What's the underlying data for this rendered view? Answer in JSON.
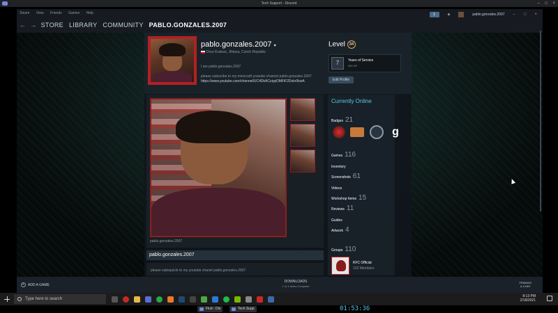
{
  "discord": {
    "title": "Tech Support - Discord"
  },
  "menubar": [
    "Steam",
    "View",
    "Friends",
    "Games",
    "Help"
  ],
  "account": {
    "badge": "1",
    "name": "pablo.gonzales.2007"
  },
  "nav": {
    "back": "←",
    "forward": "→",
    "store": "STORE",
    "library": "LIBRARY",
    "community": "COMMUNITY",
    "current": "PABLO.GONZALES.2007"
  },
  "profile": {
    "name": "pablo.gonzales.2007",
    "location": "Dvur Kralove, Jihlava, Czech Republic",
    "summary1": "I am pablo.gonzales.2007",
    "summary2": "please subscribe to my minecraft youtube channel  pablo.gonzales.2007",
    "summary3": "https://www.youtube.com/channel/UC4DkACoiypDMFiF2Dokr0kwA"
  },
  "level": {
    "label": "Level",
    "value": "34",
    "badge_title": "Years of Service",
    "badge_xp": "350 XP",
    "edit": "Edit Profile"
  },
  "showcase": {
    "caption": "pablo.gonzales.2007"
  },
  "box2": {
    "header": "pablo.gonzales.2007",
    "text": "please subsquicle to my youtube chanel pablo.gonzales.2007"
  },
  "side": {
    "online": "Currently Online",
    "badges": {
      "label": "Badges",
      "count": "21"
    },
    "games": {
      "label": "Games",
      "count": "116"
    },
    "inventory": "Inventory",
    "screenshots": {
      "label": "Screenshots",
      "count": "61"
    },
    "videos": "Videos",
    "workshop": {
      "label": "Workshop Items",
      "count": "15"
    },
    "reviews": {
      "label": "Reviews",
      "count": "11"
    },
    "guides": "Guides",
    "artwork": {
      "label": "Artwork",
      "count": "4"
    },
    "groups": {
      "label": "Groups",
      "count": "110"
    },
    "group_name": "KFC Official",
    "group_members": "123 Members"
  },
  "badge_g": "g",
  "footer": {
    "add": "ADD A GAME",
    "downloads": "DOWNLOADS",
    "downloads_sub": "1 of 1 Items Complete",
    "friends1": "FRIENDS",
    "friends2": "& CHAT"
  },
  "taskbar": {
    "search": "Type here to search",
    "time": "8:13 PM",
    "date": "2/18/2021"
  },
  "bottom": {
    "pill1": "First - Dis",
    "pill2": "Tech Supp",
    "clock": "01:53:36"
  },
  "colors": {
    "accent": "#57cbde",
    "avatar_frame": "#b32024",
    "level_ring": "#e5a93c"
  }
}
